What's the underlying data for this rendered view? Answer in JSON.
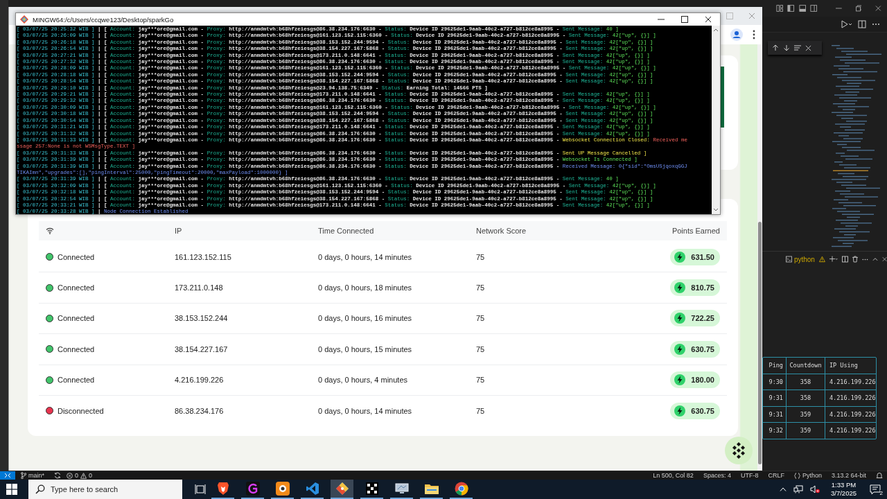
{
  "terminal": {
    "title": "MINGW64:/c/Users/ccqwe123/Desktop/sparkGo",
    "lines": [
      {
        "parts": [
          {
            "text": "[ 03/07/25 20:25:32 WIB ]",
            "kind": "time"
          },
          {
            "text": "| [",
            "kind": "plain"
          },
          {
            "text": "Account:",
            "kind": "label"
          },
          {
            "text": "jay***ore@gmail.com -",
            "kind": "plain"
          },
          {
            "text": "Proxy:",
            "kind": "label"
          },
          {
            "text": "http://anmdmtvh:b68hfzeiesgs@86.38.234.176:6630 -",
            "kind": "plain"
          },
          {
            "text": "Status:",
            "kind": "label"
          },
          {
            "text": "Device ID 29625de1-9aab-40c2-a727-b812ce8a8995 -",
            "kind": "plain"
          },
          {
            "text": "Sent Message:",
            "kind": "label"
          },
          {
            "text": "40 ]",
            "kind": "ok"
          }
        ]
      },
      {
        "parts": [
          {
            "text": "[ 03/07/25 20:26:09 WIB ]",
            "kind": "time"
          },
          {
            "text": "| [",
            "kind": "plain"
          },
          {
            "text": "Account:",
            "kind": "label"
          },
          {
            "text": "jay***ore@gmail.com -",
            "kind": "plain"
          },
          {
            "text": "Proxy:",
            "kind": "label"
          },
          {
            "text": "http://anmdmtvh:b68hfzeiesgs@161.123.152.115:6360 -",
            "kind": "plain"
          },
          {
            "text": "Status:",
            "kind": "label"
          },
          {
            "text": "Device ID 29625de1-9aab-40c2-a727-b812ce8a8995 -",
            "kind": "plain"
          },
          {
            "text": "Sent Message:",
            "kind": "label"
          },
          {
            "text": "42[\"up\", {}] ]",
            "kind": "ok"
          }
        ]
      },
      {
        "parts": [
          {
            "text": "[ 03/07/25 20:26:18 WIB ]",
            "kind": "time"
          },
          {
            "text": "| [",
            "kind": "plain"
          },
          {
            "text": "Account:",
            "kind": "label"
          },
          {
            "text": "jay***ore@gmail.com -",
            "kind": "plain"
          },
          {
            "text": "Proxy:",
            "kind": "label"
          },
          {
            "text": "http://anmdmtvh:b68hfzeiesgs@38.153.152.244:9594 -",
            "kind": "plain"
          },
          {
            "text": "Status:",
            "kind": "label"
          },
          {
            "text": "Device ID 29625de1-9aab-40c2-a727-b812ce8a8995 -",
            "kind": "plain"
          },
          {
            "text": "Sent Message:",
            "kind": "label"
          },
          {
            "text": "42[\"up\", {}] ]",
            "kind": "ok"
          }
        ]
      },
      {
        "parts": [
          {
            "text": "[ 03/07/25 20:26:54 WIB ]",
            "kind": "time"
          },
          {
            "text": "| [",
            "kind": "plain"
          },
          {
            "text": "Account:",
            "kind": "label"
          },
          {
            "text": "jay***ore@gmail.com -",
            "kind": "plain"
          },
          {
            "text": "Proxy:",
            "kind": "label"
          },
          {
            "text": "http://anmdmtvh:b68hfzeiesgs@38.154.227.167:5868 -",
            "kind": "plain"
          },
          {
            "text": "Status:",
            "kind": "label"
          },
          {
            "text": "Device ID 29625de1-9aab-40c2-a727-b812ce8a8995 -",
            "kind": "plain"
          },
          {
            "text": "Sent Message:",
            "kind": "label"
          },
          {
            "text": "42[\"up\", {}] ]",
            "kind": "ok"
          }
        ]
      },
      {
        "parts": [
          {
            "text": "[ 03/07/25 20:27:21 WIB ]",
            "kind": "time"
          },
          {
            "text": "| [",
            "kind": "plain"
          },
          {
            "text": "Account:",
            "kind": "label"
          },
          {
            "text": "jay***ore@gmail.com -",
            "kind": "plain"
          },
          {
            "text": "Proxy:",
            "kind": "label"
          },
          {
            "text": "http://anmdmtvh:b68hfzeiesgs@173.211.0.148:6641 -",
            "kind": "plain"
          },
          {
            "text": "Status:",
            "kind": "label"
          },
          {
            "text": "Device ID 29625de1-9aab-40c2-a727-b812ce8a8995 -",
            "kind": "plain"
          },
          {
            "text": "Sent Message:",
            "kind": "label"
          },
          {
            "text": "42[\"up\", {}] ]",
            "kind": "ok"
          }
        ]
      },
      {
        "parts": [
          {
            "text": "[ 03/07/25 20:27:32 WIB ]",
            "kind": "time"
          },
          {
            "text": "| [",
            "kind": "plain"
          },
          {
            "text": "Account:",
            "kind": "label"
          },
          {
            "text": "jay***ore@gmail.com -",
            "kind": "plain"
          },
          {
            "text": "Proxy:",
            "kind": "label"
          },
          {
            "text": "http://anmdmtvh:b68hfzeiesgs@86.38.234.176:6630 -",
            "kind": "plain"
          },
          {
            "text": "Status:",
            "kind": "label"
          },
          {
            "text": "Device ID 29625de1-9aab-40c2-a727-b812ce8a8995 -",
            "kind": "plain"
          },
          {
            "text": "Sent Message:",
            "kind": "label"
          },
          {
            "text": "42[\"up\", {}] ]",
            "kind": "ok"
          }
        ]
      },
      {
        "parts": [
          {
            "text": "[ 03/07/25 20:28:09 WIB ]",
            "kind": "time"
          },
          {
            "text": "| [",
            "kind": "plain"
          },
          {
            "text": "Account:",
            "kind": "label"
          },
          {
            "text": "jay***ore@gmail.com -",
            "kind": "plain"
          },
          {
            "text": "Proxy:",
            "kind": "label"
          },
          {
            "text": "http://anmdmtvh:b68hfzeiesgs@161.123.152.115:6360 -",
            "kind": "plain"
          },
          {
            "text": "Status:",
            "kind": "label"
          },
          {
            "text": "Device ID 29625de1-9aab-40c2-a727-b812ce8a8995 -",
            "kind": "plain"
          },
          {
            "text": "Sent Message:",
            "kind": "label"
          },
          {
            "text": "42[\"up\", {}] ]",
            "kind": "ok"
          }
        ]
      },
      {
        "parts": [
          {
            "text": "[ 03/07/25 20:28:18 WIB ]",
            "kind": "time"
          },
          {
            "text": "| [",
            "kind": "plain"
          },
          {
            "text": "Account:",
            "kind": "label"
          },
          {
            "text": "jay***ore@gmail.com -",
            "kind": "plain"
          },
          {
            "text": "Proxy:",
            "kind": "label"
          },
          {
            "text": "http://anmdmtvh:b68hfzeiesgs@38.153.152.244:9594 -",
            "kind": "plain"
          },
          {
            "text": "Status:",
            "kind": "label"
          },
          {
            "text": "Device ID 29625de1-9aab-40c2-a727-b812ce8a8995 -",
            "kind": "plain"
          },
          {
            "text": "Sent Message:",
            "kind": "label"
          },
          {
            "text": "42[\"up\", {}] ]",
            "kind": "ok"
          }
        ]
      },
      {
        "parts": [
          {
            "text": "[ 03/07/25 20:28:54 WIB ]",
            "kind": "time"
          },
          {
            "text": "| [",
            "kind": "plain"
          },
          {
            "text": "Account:",
            "kind": "label"
          },
          {
            "text": "jay***ore@gmail.com -",
            "kind": "plain"
          },
          {
            "text": "Proxy:",
            "kind": "label"
          },
          {
            "text": "http://anmdmtvh:b68hfzeiesgs@38.154.227.167:5868 -",
            "kind": "plain"
          },
          {
            "text": "Status:",
            "kind": "label"
          },
          {
            "text": "Device ID 29625de1-9aab-40c2-a727-b812ce8a8995 -",
            "kind": "plain"
          },
          {
            "text": "Sent Message:",
            "kind": "label"
          },
          {
            "text": "42[\"up\", {}] ]",
            "kind": "ok"
          }
        ]
      },
      {
        "parts": [
          {
            "text": "[ 03/07/25 20:29:10 WIB ]",
            "kind": "time"
          },
          {
            "text": "| [",
            "kind": "plain"
          },
          {
            "text": "Account:",
            "kind": "label"
          },
          {
            "text": "jay***ore@gmail.com -",
            "kind": "plain"
          },
          {
            "text": "Proxy:",
            "kind": "label"
          },
          {
            "text": "http://anmdmtvh:b68hfzeiesgs@23.94.138.75:6349 -",
            "kind": "plain"
          },
          {
            "text": "Status:",
            "kind": "label"
          },
          {
            "text": "Earning Total: 14566 PTS ]",
            "kind": "plain"
          }
        ]
      },
      {
        "parts": [
          {
            "text": "[ 03/07/25 20:29:21 WIB ]",
            "kind": "time"
          },
          {
            "text": "| [",
            "kind": "plain"
          },
          {
            "text": "Account:",
            "kind": "label"
          },
          {
            "text": "jay***ore@gmail.com -",
            "kind": "plain"
          },
          {
            "text": "Proxy:",
            "kind": "label"
          },
          {
            "text": "http://anmdmtvh:b68hfzeiesgs@173.211.0.148:6641 -",
            "kind": "plain"
          },
          {
            "text": "Status:",
            "kind": "label"
          },
          {
            "text": "Device ID 29625de1-9aab-40c2-a727-b812ce8a8995 -",
            "kind": "plain"
          },
          {
            "text": "Sent Message:",
            "kind": "label"
          },
          {
            "text": "42[\"up\", {}] ]",
            "kind": "ok"
          }
        ]
      },
      {
        "parts": [
          {
            "text": "[ 03/07/25 20:29:32 WIB ]",
            "kind": "time"
          },
          {
            "text": "| [",
            "kind": "plain"
          },
          {
            "text": "Account:",
            "kind": "label"
          },
          {
            "text": "jay***ore@gmail.com -",
            "kind": "plain"
          },
          {
            "text": "Proxy:",
            "kind": "label"
          },
          {
            "text": "http://anmdmtvh:b68hfzeiesgs@86.38.234.176:6630 -",
            "kind": "plain"
          },
          {
            "text": "Status:",
            "kind": "label"
          },
          {
            "text": "Device ID 29625de1-9aab-40c2-a727-b812ce8a8995 -",
            "kind": "plain"
          },
          {
            "text": "Sent Message:",
            "kind": "label"
          },
          {
            "text": "42[\"up\", {}] ]",
            "kind": "ok"
          }
        ]
      },
      {
        "parts": [
          {
            "text": "[ 03/07/25 20:30:09 WIB ]",
            "kind": "time"
          },
          {
            "text": "| [",
            "kind": "plain"
          },
          {
            "text": "Account:",
            "kind": "label"
          },
          {
            "text": "jay***ore@gmail.com -",
            "kind": "plain"
          },
          {
            "text": "Proxy:",
            "kind": "label"
          },
          {
            "text": "http://anmdmtvh:b68hfzeiesgs@161.123.152.115:6360 -",
            "kind": "plain"
          },
          {
            "text": "Status:",
            "kind": "label"
          },
          {
            "text": "Device ID 29625de1-9aab-40c2-a727-b812ce8a8995 -",
            "kind": "plain"
          },
          {
            "text": "Sent Message:",
            "kind": "label"
          },
          {
            "text": "42[\"up\", {}] ]",
            "kind": "ok"
          }
        ]
      },
      {
        "parts": [
          {
            "text": "[ 03/07/25 20:30:18 WIB ]",
            "kind": "time"
          },
          {
            "text": "| [",
            "kind": "plain"
          },
          {
            "text": "Account:",
            "kind": "label"
          },
          {
            "text": "jay***ore@gmail.com -",
            "kind": "plain"
          },
          {
            "text": "Proxy:",
            "kind": "label"
          },
          {
            "text": "http://anmdmtvh:b68hfzeiesgs@38.153.152.244:9594 -",
            "kind": "plain"
          },
          {
            "text": "Status:",
            "kind": "label"
          },
          {
            "text": "Device ID 29625de1-9aab-40c2-a727-b812ce8a8995 -",
            "kind": "plain"
          },
          {
            "text": "Sent Message:",
            "kind": "label"
          },
          {
            "text": "42[\"up\", {}] ]",
            "kind": "ok"
          }
        ]
      },
      {
        "parts": [
          {
            "text": "[ 03/07/25 20:30:54 WIB ]",
            "kind": "time"
          },
          {
            "text": "| [",
            "kind": "plain"
          },
          {
            "text": "Account:",
            "kind": "label"
          },
          {
            "text": "jay***ore@gmail.com -",
            "kind": "plain"
          },
          {
            "text": "Proxy:",
            "kind": "label"
          },
          {
            "text": "http://anmdmtvh:b68hfzeiesgs@38.154.227.167:5868 -",
            "kind": "plain"
          },
          {
            "text": "Status:",
            "kind": "label"
          },
          {
            "text": "Device ID 29625de1-9aab-40c2-a727-b812ce8a8995 -",
            "kind": "plain"
          },
          {
            "text": "Sent Message:",
            "kind": "label"
          },
          {
            "text": "42[\"up\", {}] ]",
            "kind": "ok"
          }
        ]
      },
      {
        "parts": [
          {
            "text": "[ 03/07/25 20:31:21 WIB ]",
            "kind": "time"
          },
          {
            "text": "| [",
            "kind": "plain"
          },
          {
            "text": "Account:",
            "kind": "label"
          },
          {
            "text": "jay***ore@gmail.com -",
            "kind": "plain"
          },
          {
            "text": "Proxy:",
            "kind": "label"
          },
          {
            "text": "http://anmdmtvh:b68hfzeiesgs@173.211.0.148:6641 -",
            "kind": "plain"
          },
          {
            "text": "Status:",
            "kind": "label"
          },
          {
            "text": "Device ID 29625de1-9aab-40c2-a727-b812ce8a8995 -",
            "kind": "plain"
          },
          {
            "text": "Sent Message:",
            "kind": "label"
          },
          {
            "text": "42[\"up\", {}] ]",
            "kind": "ok"
          }
        ]
      },
      {
        "parts": [
          {
            "text": "[ 03/07/25 20:31:32 WIB ]",
            "kind": "time"
          },
          {
            "text": "| [",
            "kind": "plain"
          },
          {
            "text": "Account:",
            "kind": "label"
          },
          {
            "text": "jay***ore@gmail.com -",
            "kind": "plain"
          },
          {
            "text": "Proxy:",
            "kind": "label"
          },
          {
            "text": "http://anmdmtvh:b68hfzeiesgs@86.38.234.176:6630 -",
            "kind": "plain"
          },
          {
            "text": "Status:",
            "kind": "label"
          },
          {
            "text": "Device ID 29625de1-9aab-40c2-a727-b812ce8a8995 -",
            "kind": "plain"
          },
          {
            "text": "Sent Message:",
            "kind": "label"
          },
          {
            "text": "42[\"up\", {}] ]",
            "kind": "ok"
          }
        ]
      },
      {
        "parts": [
          {
            "text": "[ 03/07/25 20:31:33 WIB ]",
            "kind": "time"
          },
          {
            "text": "| [",
            "kind": "plain"
          },
          {
            "text": "Account:",
            "kind": "label"
          },
          {
            "text": "jay***ore@gmail.com -",
            "kind": "plain"
          },
          {
            "text": "Proxy:",
            "kind": "label"
          },
          {
            "text": "http://anmdmtvh:b68hfzeiesgs@86.38.234.176:6630 -",
            "kind": "plain"
          },
          {
            "text": "Status:",
            "kind": "label"
          },
          {
            "text": "Device ID 29625de1-9aab-40c2-a727-b812ce8a8995 -",
            "kind": "plain"
          },
          {
            "text": "Websocket Connection Closed:",
            "kind": "warn"
          },
          {
            "text": "Received me",
            "kind": "err"
          }
        ]
      },
      {
        "parts": [
          {
            "text": "ssage 257:None is not WSMsgType.TEXT ]",
            "kind": "err"
          }
        ]
      },
      {
        "parts": [
          {
            "text": "[ 03/07/25 20:31:33 WIB ]",
            "kind": "time"
          },
          {
            "text": "| [",
            "kind": "plain"
          },
          {
            "text": "Account:",
            "kind": "label"
          },
          {
            "text": "jay***ore@gmail.com -",
            "kind": "plain"
          },
          {
            "text": "Proxy:",
            "kind": "label"
          },
          {
            "text": "http://anmdmtvh:b68hfzeiesgs@86.38.234.176:6630 -",
            "kind": "plain"
          },
          {
            "text": "Status:",
            "kind": "label"
          },
          {
            "text": "Device ID 29625de1-9aab-40c2-a727-b812ce8a8995 -",
            "kind": "plain"
          },
          {
            "text": "Sent UP Message Cancelled ]",
            "kind": "warn"
          }
        ]
      },
      {
        "parts": [
          {
            "text": "[ 03/07/25 20:31:39 WIB ]",
            "kind": "time"
          },
          {
            "text": "| [",
            "kind": "plain"
          },
          {
            "text": "Account:",
            "kind": "label"
          },
          {
            "text": "jay***ore@gmail.com -",
            "kind": "plain"
          },
          {
            "text": "Proxy:",
            "kind": "label"
          },
          {
            "text": "http://anmdmtvh:b68hfzeiesgs@86.38.234.176:6630 -",
            "kind": "plain"
          },
          {
            "text": "Status:",
            "kind": "label"
          },
          {
            "text": "Device ID 29625de1-9aab-40c2-a727-b812ce8a8995 -",
            "kind": "plain"
          },
          {
            "text": "Websocket Is Connected ]",
            "kind": "ok"
          }
        ]
      },
      {
        "parts": [
          {
            "text": "[ 03/07/25 20:31:39 WIB ]",
            "kind": "time"
          },
          {
            "text": "| [",
            "kind": "plain"
          },
          {
            "text": "Account:",
            "kind": "label"
          },
          {
            "text": "jay***ore@gmail.com -",
            "kind": "plain"
          },
          {
            "text": "Proxy:",
            "kind": "label"
          },
          {
            "text": "http://anmdmtvh:b68hfzeiesgs@86.38.234.176:6630 -",
            "kind": "plain"
          },
          {
            "text": "Status:",
            "kind": "label"
          },
          {
            "text": "Device ID 29625de1-9aab-40c2-a727-b812ce8a8995 -",
            "kind": "plain"
          },
          {
            "text": "Received Message:",
            "kind": "info"
          },
          {
            "text": "0{\"sid\":\"OmsUSjqoxqGGJ",
            "kind": "info"
          }
        ]
      },
      {
        "parts": [
          {
            "text": "TIKAImn\",\"upgrades\":[],\"pingInterval\":25000,\"pingTimeout\":20000,\"maxPayload\":1000000} ]",
            "kind": "info"
          }
        ]
      },
      {
        "parts": [
          {
            "text": "[ 03/07/25 20:31:39 WIB ]",
            "kind": "time"
          },
          {
            "text": "| [",
            "kind": "plain"
          },
          {
            "text": "Account:",
            "kind": "label"
          },
          {
            "text": "jay***ore@gmail.com -",
            "kind": "plain"
          },
          {
            "text": "Proxy:",
            "kind": "label"
          },
          {
            "text": "http://anmdmtvh:b68hfzeiesgs@86.38.234.176:6630 -",
            "kind": "plain"
          },
          {
            "text": "Status:",
            "kind": "label"
          },
          {
            "text": "Device ID 29625de1-9aab-40c2-a727-b812ce8a8995 -",
            "kind": "plain"
          },
          {
            "text": "Sent Message:",
            "kind": "label"
          },
          {
            "text": "40 ]",
            "kind": "ok"
          }
        ]
      },
      {
        "parts": [
          {
            "text": "[ 03/07/25 20:32:09 WIB ]",
            "kind": "time"
          },
          {
            "text": "| [",
            "kind": "plain"
          },
          {
            "text": "Account:",
            "kind": "label"
          },
          {
            "text": "jay***ore@gmail.com -",
            "kind": "plain"
          },
          {
            "text": "Proxy:",
            "kind": "label"
          },
          {
            "text": "http://anmdmtvh:b68hfzeiesgs@161.123.152.115:6360 -",
            "kind": "plain"
          },
          {
            "text": "Status:",
            "kind": "label"
          },
          {
            "text": "Device ID 29625de1-9aab-40c2-a727-b812ce8a8995 -",
            "kind": "plain"
          },
          {
            "text": "Sent Message:",
            "kind": "label"
          },
          {
            "text": "42[\"up\", {}] ]",
            "kind": "ok"
          }
        ]
      },
      {
        "parts": [
          {
            "text": "[ 03/07/25 20:32:18 WIB ]",
            "kind": "time"
          },
          {
            "text": "| [",
            "kind": "plain"
          },
          {
            "text": "Account:",
            "kind": "label"
          },
          {
            "text": "jay***ore@gmail.com -",
            "kind": "plain"
          },
          {
            "text": "Proxy:",
            "kind": "label"
          },
          {
            "text": "http://anmdmtvh:b68hfzeiesgs@38.153.152.244:9594 -",
            "kind": "plain"
          },
          {
            "text": "Status:",
            "kind": "label"
          },
          {
            "text": "Device ID 29625de1-9aab-40c2-a727-b812ce8a8995 -",
            "kind": "plain"
          },
          {
            "text": "Sent Message:",
            "kind": "label"
          },
          {
            "text": "42[\"up\", {}] ]",
            "kind": "ok"
          }
        ]
      },
      {
        "parts": [
          {
            "text": "[ 03/07/25 20:32:54 WIB ]",
            "kind": "time"
          },
          {
            "text": "| [",
            "kind": "plain"
          },
          {
            "text": "Account:",
            "kind": "label"
          },
          {
            "text": "jay***ore@gmail.com -",
            "kind": "plain"
          },
          {
            "text": "Proxy:",
            "kind": "label"
          },
          {
            "text": "http://anmdmtvh:b68hfzeiesgs@38.154.227.167:5868 -",
            "kind": "plain"
          },
          {
            "text": "Status:",
            "kind": "label"
          },
          {
            "text": "Device ID 29625de1-9aab-40c2-a727-b812ce8a8995 -",
            "kind": "plain"
          },
          {
            "text": "Sent Message:",
            "kind": "label"
          },
          {
            "text": "42[\"up\", {}] ]",
            "kind": "ok"
          }
        ]
      },
      {
        "parts": [
          {
            "text": "[ 03/07/25 20:33:21 WIB ]",
            "kind": "time"
          },
          {
            "text": "| [",
            "kind": "plain"
          },
          {
            "text": "Account:",
            "kind": "label"
          },
          {
            "text": "jay***ore@gmail.com -",
            "kind": "plain"
          },
          {
            "text": "Proxy:",
            "kind": "label"
          },
          {
            "text": "http://anmdmtvh:b68hfzeiesgs@173.211.0.148:6641 -",
            "kind": "plain"
          },
          {
            "text": "Status:",
            "kind": "label"
          },
          {
            "text": "Device ID 29625de1-9aab-40c2-a727-b812ce8a8995 -",
            "kind": "plain"
          },
          {
            "text": "Sent Message:",
            "kind": "label"
          },
          {
            "text": "42[\"up\", {}] ]",
            "kind": "ok"
          }
        ]
      },
      {
        "parts": [
          {
            "text": "[ 03/07/25 20:33:28 WIB ]",
            "kind": "time"
          },
          {
            "text": "|",
            "kind": "plain"
          },
          {
            "text": "Node Connection Established",
            "kind": "info"
          }
        ]
      }
    ]
  },
  "nodes_table": {
    "columns": [
      "IP",
      "Time Connected",
      "Network Score",
      "Points Earned"
    ],
    "rows": [
      {
        "status": "Connected",
        "connected": true,
        "ip": "161.123.152.115",
        "time": "0 days, 0 hours, 14 minutes",
        "score": "75",
        "points": "631.50"
      },
      {
        "status": "Connected",
        "connected": true,
        "ip": "173.211.0.148",
        "time": "0 days, 0 hours, 18 minutes",
        "score": "75",
        "points": "810.75"
      },
      {
        "status": "Connected",
        "connected": true,
        "ip": "38.153.152.244",
        "time": "0 days, 0 hours, 16 minutes",
        "score": "75",
        "points": "722.25"
      },
      {
        "status": "Connected",
        "connected": true,
        "ip": "38.154.227.167",
        "time": "0 days, 0 hours, 15 minutes",
        "score": "75",
        "points": "630.75"
      },
      {
        "status": "Connected",
        "connected": true,
        "ip": "4.216.199.226",
        "time": "0 days, 0 hours, 4 minutes",
        "score": "75",
        "points": "180.00"
      },
      {
        "status": "Disconnected",
        "connected": false,
        "ip": "86.38.234.176",
        "time": "0 days, 0 hours, 14 minutes",
        "score": "75",
        "points": "630.75"
      }
    ]
  },
  "editor": {
    "panel_tab": "python",
    "table": {
      "columns": [
        "Ping",
        "Countdown",
        "IP Using"
      ],
      "rows": [
        [
          "9:30",
          "358",
          "4.216.199.226"
        ],
        [
          "9:31",
          "358",
          "4.216.199.226"
        ],
        [
          "9:31",
          "359",
          "4.216.199.226"
        ],
        [
          "9:32",
          "359",
          "4.216.199.226"
        ]
      ]
    },
    "status_bar": {
      "branch": "main*",
      "errors": "0",
      "warnings": "0",
      "items": [
        "Ln 500, Col 82",
        "Spaces: 4",
        "UTF-8",
        "CRLF"
      ],
      "language": "Python",
      "interpreter": "3.13.2 64-bit"
    }
  },
  "taskbar": {
    "search": {
      "placeholder": "Type here to search"
    },
    "apps": [
      {
        "kind": "brave",
        "selected": false
      },
      {
        "kind": "letter",
        "selected": false
      },
      {
        "kind": "orange",
        "selected": false
      },
      {
        "kind": "vscode",
        "selected": false
      },
      {
        "kind": "git",
        "selected": true
      },
      {
        "kind": "grid",
        "selected": false
      },
      {
        "kind": "remote",
        "selected": false
      },
      {
        "kind": "files",
        "selected": false
      },
      {
        "kind": "chrome",
        "selected": false
      }
    ],
    "time": "1:33 PM",
    "date": "3/7/2025",
    "notifications": "2"
  }
}
